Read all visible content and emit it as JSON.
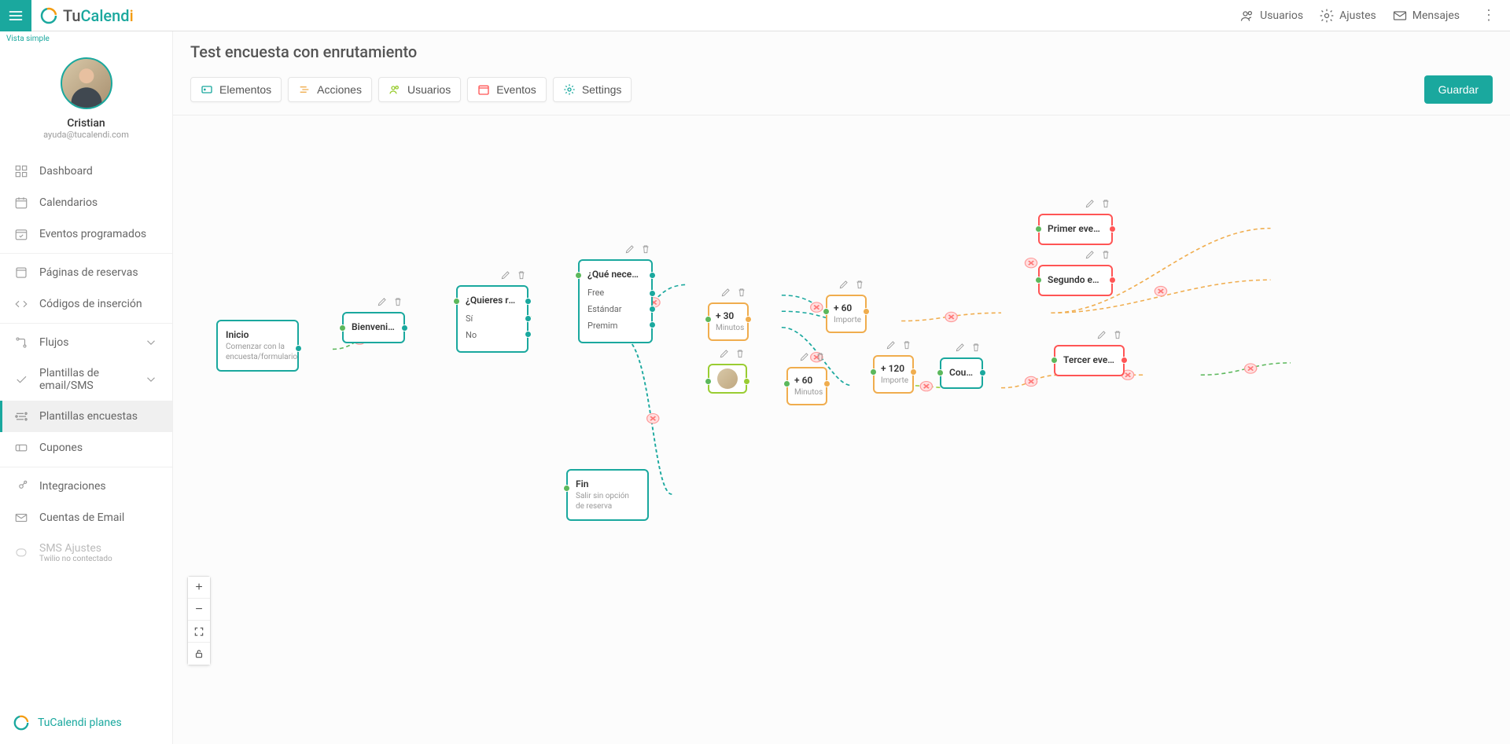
{
  "brand": {
    "tu": "Tu",
    "calend": "Calend",
    "i": "i"
  },
  "topbar": {
    "users": "Usuarios",
    "settings": "Ajustes",
    "messages": "Mensajes"
  },
  "sidebar": {
    "vista_simple": "Vista simple",
    "profile": {
      "name": "Cristian",
      "email": "ayuda@tucalendi.com"
    },
    "items": {
      "dashboard": "Dashboard",
      "calendars": "Calendarios",
      "scheduled": "Eventos programados",
      "booking_pages": "Páginas de reservas",
      "embed": "Códigos de inserción",
      "flows": "Flujos",
      "templates": "Plantillas de email/SMS",
      "surveys": "Plantillas encuestas",
      "coupons": "Cupones",
      "integrations": "Integraciones",
      "email_accounts": "Cuentas de Email",
      "sms": "SMS Ajustes",
      "sms_sub": "Twilio no contectado"
    },
    "footer": "TuCalendi planes"
  },
  "page": {
    "title": "Test encuesta con enrutamiento",
    "toolbar": {
      "elements": "Elementos",
      "actions": "Acciones",
      "users": "Usuarios",
      "events": "Eventos",
      "settings": "Settings"
    },
    "save": "Guardar"
  },
  "nodes": {
    "inicio": {
      "title": "Inicio",
      "sub": "Comenzar con la encuesta/formulario"
    },
    "bienvenido": {
      "title": "Bienvenido"
    },
    "quieres": {
      "title": "¿Quieres rese…",
      "opts": [
        "Sí",
        "No"
      ]
    },
    "que": {
      "title": "¿Qué necesit…",
      "opts": [
        "Free",
        "Estándar",
        "Premim"
      ]
    },
    "fin": {
      "title": "Fin",
      "sub": "Salir sin opción de reserva"
    },
    "min30": {
      "title": "+ 30",
      "sub": "Minutos"
    },
    "min60_import": {
      "title": "+ 60",
      "sub": "Importe"
    },
    "min60": {
      "title": "+ 60",
      "sub": "Minutos"
    },
    "min120": {
      "title": "+ 120",
      "sub": "Importe"
    },
    "coupon": {
      "title": "Coupon"
    },
    "primer": {
      "title": "Primer evento"
    },
    "segundo": {
      "title": "Segundo eve…"
    },
    "tercer": {
      "title": "Tercer evento"
    }
  }
}
